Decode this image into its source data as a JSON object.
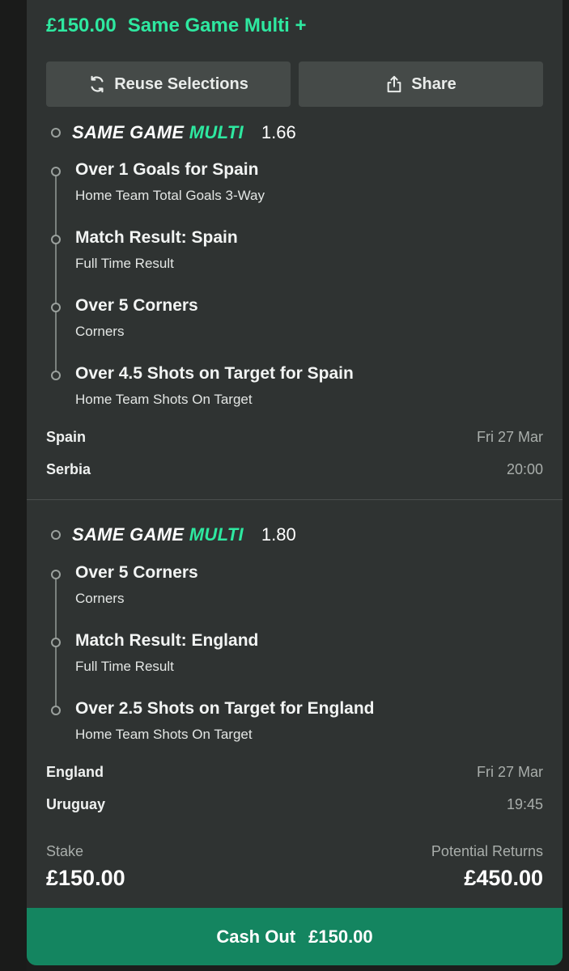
{
  "header": {
    "amount": "£150.00",
    "bet_type": "Same Game Multi +"
  },
  "actions": {
    "reuse_label": "Reuse Selections",
    "share_label": "Share"
  },
  "sgm_logo": {
    "part1": "SAME GAME",
    "part2": "MULTI"
  },
  "multis": [
    {
      "odds": "1.66",
      "legs": [
        {
          "title": "Over 1 Goals for Spain",
          "market": "Home Team Total Goals 3-Way"
        },
        {
          "title": "Match Result: Spain",
          "market": "Full Time Result"
        },
        {
          "title": "Over 5 Corners",
          "market": "Corners"
        },
        {
          "title": "Over 4.5 Shots on Target for Spain",
          "market": "Home Team Shots On Target"
        }
      ],
      "home_team": "Spain",
      "away_team": "Serbia",
      "date": "Fri 27 Mar",
      "time": "20:00"
    },
    {
      "odds": "1.80",
      "legs": [
        {
          "title": "Over 5 Corners",
          "market": "Corners"
        },
        {
          "title": "Match Result: England",
          "market": "Full Time Result"
        },
        {
          "title": "Over 2.5 Shots on Target for England",
          "market": "Home Team Shots On Target"
        }
      ],
      "home_team": "England",
      "away_team": "Uruguay",
      "date": "Fri 27 Mar",
      "time": "19:45"
    }
  ],
  "footer": {
    "stake_label": "Stake",
    "stake_value": "£150.00",
    "returns_label": "Potential Returns",
    "returns_value": "£450.00"
  },
  "cashout": {
    "label": "Cash Out",
    "amount": "£150.00"
  },
  "icons": {
    "reuse": "refresh-icon",
    "share": "share-icon"
  },
  "colors": {
    "accent": "#2ee8a0",
    "cashout_bg": "#148560",
    "card_bg": "#2f3332"
  }
}
